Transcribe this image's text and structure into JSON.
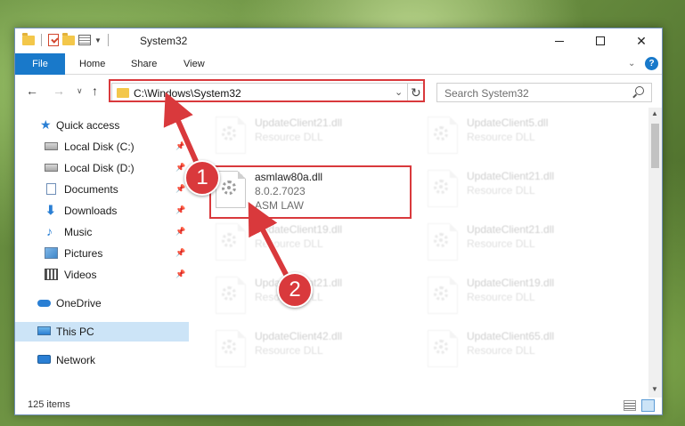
{
  "window": {
    "title": "System32"
  },
  "ribbon": {
    "tabs": [
      "File",
      "Home",
      "Share",
      "View"
    ]
  },
  "address": {
    "path": "C:\\Windows\\System32",
    "search_placeholder": "Search System32"
  },
  "nav": {
    "items": [
      {
        "label": "Quick access",
        "icon": "star-icon",
        "pinned": false
      },
      {
        "label": "Local Disk (C:)",
        "icon": "disk-icon",
        "pinned": true
      },
      {
        "label": "Local Disk (D:)",
        "icon": "disk-icon",
        "pinned": true
      },
      {
        "label": "Documents",
        "icon": "documents-icon",
        "pinned": true
      },
      {
        "label": "Downloads",
        "icon": "download-icon",
        "pinned": true
      },
      {
        "label": "Music",
        "icon": "music-icon",
        "pinned": true
      },
      {
        "label": "Pictures",
        "icon": "pictures-icon",
        "pinned": true
      },
      {
        "label": "Videos",
        "icon": "videos-icon",
        "pinned": true
      },
      {
        "label": "OneDrive",
        "icon": "onedrive-icon",
        "pinned": false
      },
      {
        "label": "This PC",
        "icon": "this-pc-icon",
        "pinned": false,
        "selected": true
      },
      {
        "label": "Network",
        "icon": "network-icon",
        "pinned": false
      }
    ]
  },
  "files": {
    "highlighted": {
      "name": "asmlaw80a.dll",
      "version": "8.0.2.7023",
      "company": "ASM LAW"
    },
    "left_column": [
      {
        "name": "UpdateClient21.dll",
        "type": "Resource DLL"
      },
      {
        "name": "UpdateClient19.dll",
        "type": "Resource DLL"
      },
      {
        "name": "UpdateClient21.dll",
        "type": "Resource DLL"
      },
      {
        "name": "UpdateClient42.dll",
        "type": "Resource DLL"
      }
    ],
    "right_column": [
      {
        "name": "UpdateClient5.dll",
        "type": "Resource DLL"
      },
      {
        "name": "UpdateClient21.dll",
        "type": "Resource DLL"
      },
      {
        "name": "UpdateClient21.dll",
        "type": "Resource DLL"
      },
      {
        "name": "UpdateClient19.dll",
        "type": "Resource DLL"
      },
      {
        "name": "UpdateClient65.dll",
        "type": "Resource DLL"
      }
    ]
  },
  "status": {
    "item_count": "125 items"
  },
  "callouts": [
    "1",
    "2"
  ],
  "colors": {
    "accent": "#1979ca",
    "highlight": "#d9393c",
    "selected_bg": "#cce4f7"
  }
}
